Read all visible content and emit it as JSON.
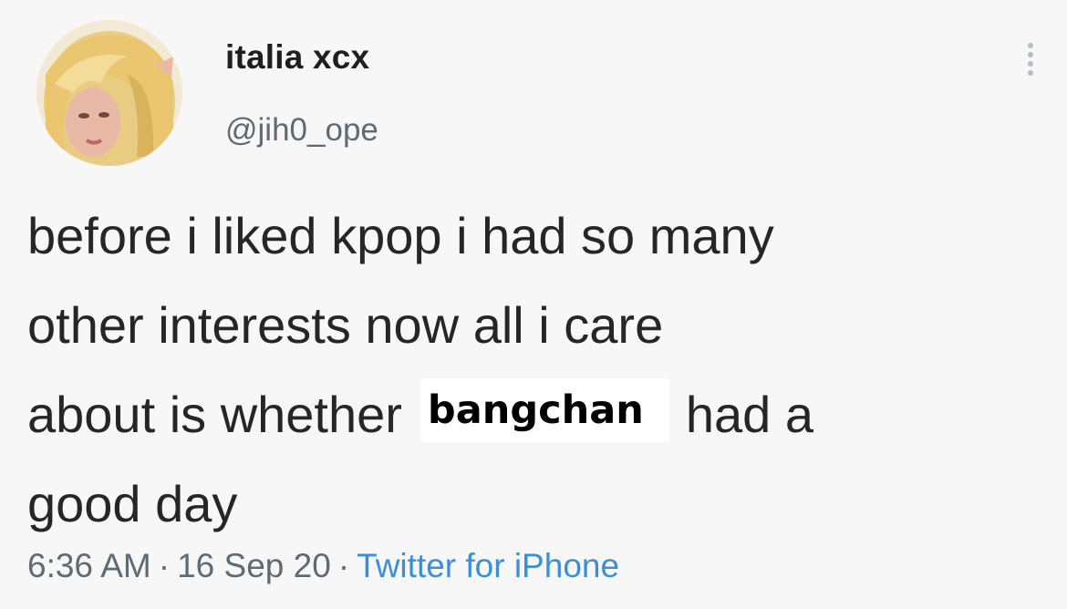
{
  "user": {
    "display_name": "italia xcx",
    "handle": "@jih0_ope"
  },
  "tweet": {
    "line1": "before i liked kpop i had so many",
    "line2": "other interests now all i care",
    "line3_before": "about is whether",
    "redacted_name": "bangchan",
    "line3_after": "had a",
    "line4": "good day"
  },
  "meta": {
    "time": "6:36 AM",
    "separator": "·",
    "date": "16 Sep 20",
    "source": "Twitter for iPhone"
  },
  "icons": {
    "more": "more-vertical-icon",
    "avatar": "avatar-image"
  },
  "colors": {
    "background": "#f7f7f7",
    "text": "#262626",
    "secondary": "#5f6a72",
    "link": "#3a8fd6"
  }
}
